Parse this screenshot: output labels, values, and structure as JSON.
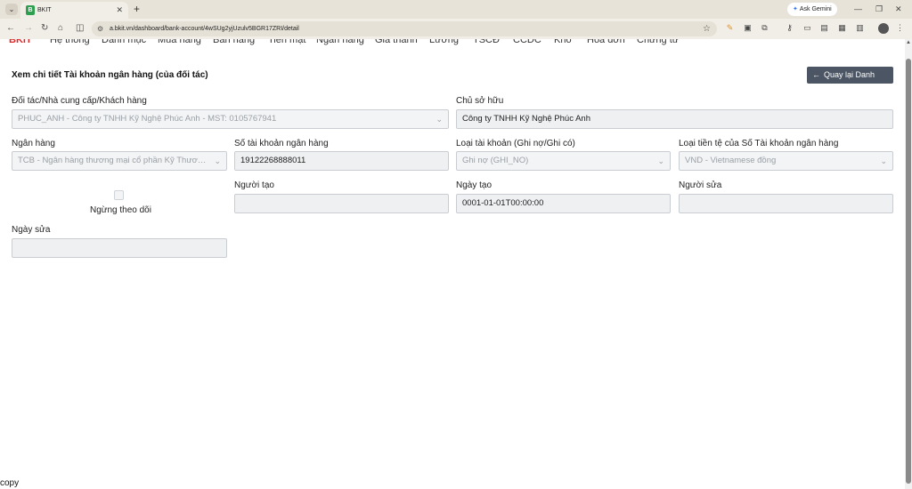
{
  "browser": {
    "tab_title": "BKIT",
    "favicon_letter": "B",
    "url": "a.bkit.vn/dashboard/bank-account/4wSUg2yjUzulv5BGR17ZRI/detail",
    "gemini_label": "Ask Gemini"
  },
  "appnav": {
    "logo": "BKIT",
    "items": [
      "Hệ thống",
      "Danh mục",
      "Mua hàng",
      "Bán hàng",
      "Tiền mặt",
      "Ngân hàng",
      "Giá thành",
      "Lương",
      "TSCĐ",
      "CCDC",
      "Kho",
      "Hóa đơn",
      "Chứng từ"
    ]
  },
  "page": {
    "title": "Xem chi tiết Tài khoản ngân hàng (của đối tác)",
    "back_label": "Quay lại Danh sách"
  },
  "form": {
    "partner_label": "Đối tác/Nhà cung cấp/Khách hàng",
    "partner_value": "PHUC_ANH - Công ty TNHH Kỹ Nghệ Phúc Anh - MST: 0105767941",
    "owner_label": "Chủ sở hữu",
    "owner_value": "Công ty TNHH Kỹ Nghệ Phúc Anh",
    "bank_label": "Ngân hàng",
    "bank_value": "TCB - Ngân hàng thương mại cổ phần Kỹ Thương Việt Nam",
    "account_no_label": "Số tài khoản ngân hàng",
    "account_no_value": "19122268888011",
    "account_type_label": "Loại tài khoản (Ghi nợ/Ghi có)",
    "account_type_value": "Ghi nợ (GHI_NO)",
    "currency_label": "Loại tiền tệ của Số Tài khoản ngân hàng",
    "currency_value": "VND - Vietnamese đồng",
    "stop_tracking_label": "Ngừng theo dõi",
    "creator_label": "Người tạo",
    "creator_value": "",
    "created_date_label": "Ngày tạo",
    "created_date_value": "0001-01-01T00:00:00",
    "editor_label": "Người sửa",
    "editor_value": "",
    "edited_date_label": "Ngày sửa",
    "edited_date_value": ""
  },
  "footer": {
    "copy_text": "copy"
  }
}
